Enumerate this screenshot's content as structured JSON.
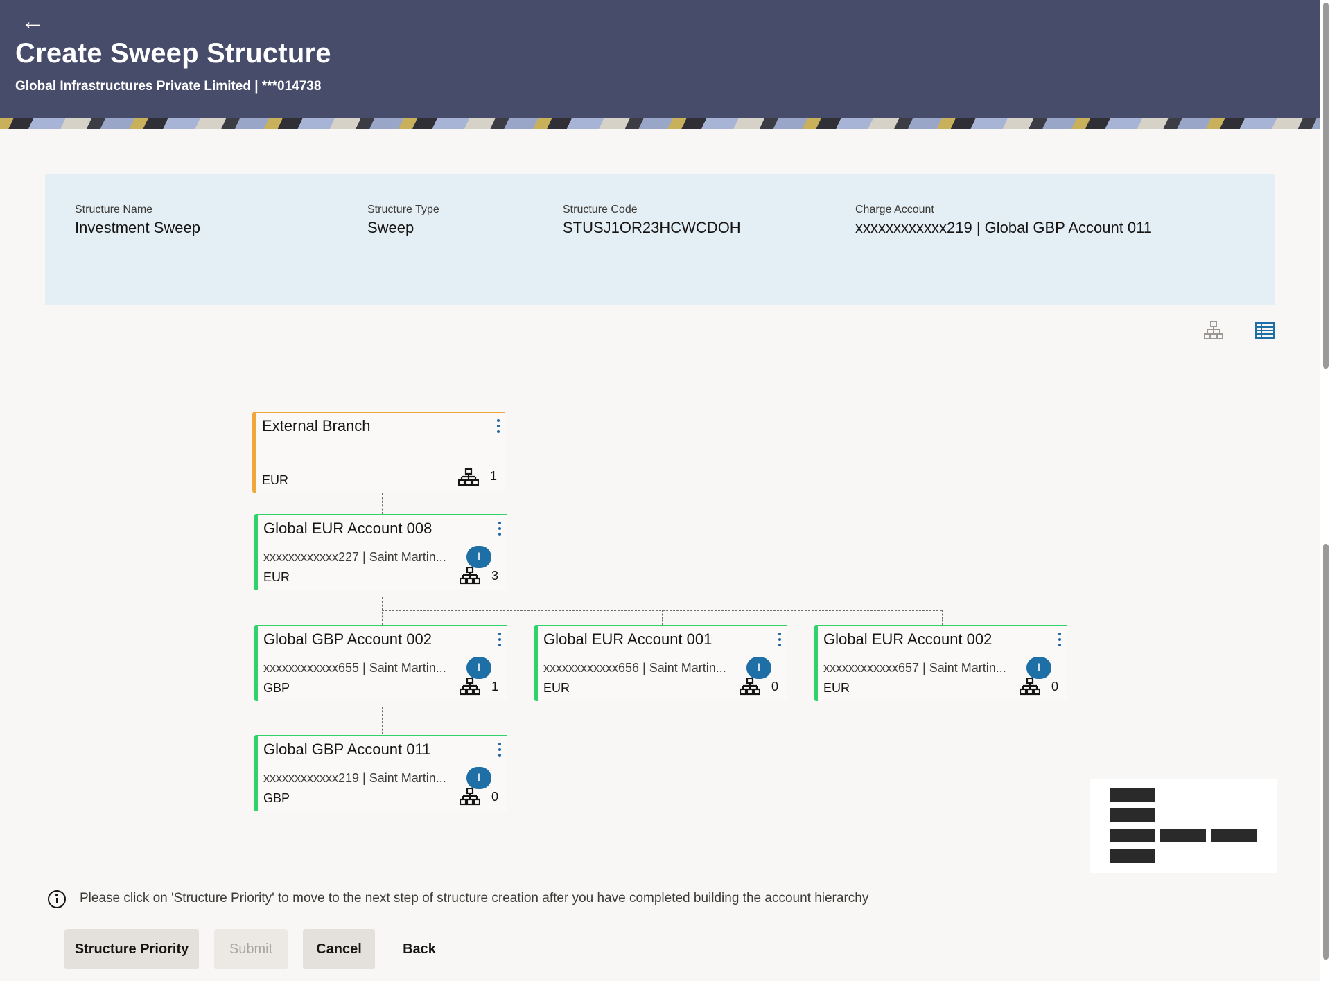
{
  "header": {
    "title": "Create Sweep Structure",
    "subtitle": "Global Infrastructures Private Limited | ***014738"
  },
  "info": {
    "structure_name_label": "Structure Name",
    "structure_name_value": "Investment Sweep",
    "structure_type_label": "Structure Type",
    "structure_type_value": "Sweep",
    "structure_code_label": "Structure Code",
    "structure_code_value": "STUSJ1OR23HCWCDOH",
    "charge_account_label": "Charge Account",
    "charge_account_value": "xxxxxxxxxxxx219 | Global GBP Account 011"
  },
  "views": {
    "tree_icon": "hierarchy-icon",
    "table_icon": "grid-table-icon"
  },
  "tree": {
    "root": {
      "title": "External Branch",
      "currency": "EUR",
      "child_count": "1"
    },
    "nodes": [
      {
        "title": "Global EUR Account 008",
        "account": "xxxxxxxxxxxx227 | Saint Martin...",
        "badge": "I",
        "currency": "EUR",
        "child_count": "3"
      },
      {
        "title": "Global GBP Account 002",
        "account": "xxxxxxxxxxxx655 | Saint Martin...",
        "badge": "I",
        "currency": "GBP",
        "child_count": "1"
      },
      {
        "title": "Global EUR Account 001",
        "account": "xxxxxxxxxxxx656 | Saint Martin...",
        "badge": "I",
        "currency": "EUR",
        "child_count": "0"
      },
      {
        "title": "Global EUR Account 002",
        "account": "xxxxxxxxxxxx657 | Saint Martin...",
        "badge": "I",
        "currency": "EUR",
        "child_count": "0"
      },
      {
        "title": "Global GBP Account 011",
        "account": "xxxxxxxxxxxx219 | Saint Martin...",
        "badge": "I",
        "currency": "GBP",
        "child_count": "0"
      }
    ]
  },
  "footer": {
    "note": "Please click on 'Structure Priority' to move to the next step of structure creation after you have completed building the account hierarchy",
    "buttons": {
      "structure_priority": "Structure Priority",
      "submit": "Submit",
      "cancel": "Cancel",
      "back": "Back"
    }
  },
  "colors": {
    "header_bg": "#474c6a",
    "info_bg": "#e3eff5",
    "root_accent": "#f0a83a",
    "node_accent": "#2fd36a",
    "badge": "#1d6fa5"
  }
}
